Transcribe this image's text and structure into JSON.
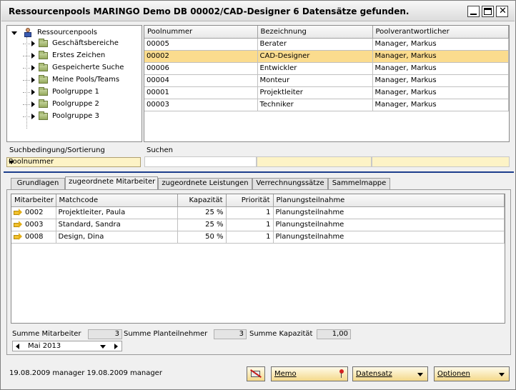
{
  "window": {
    "title": "Ressourcenpools MARINGO Demo DB 00002/CAD-Designer  6 Datensätze gefunden."
  },
  "tree": {
    "root": "Ressourcenpools",
    "items": [
      {
        "label": "Geschäftsbereiche"
      },
      {
        "label": "Erstes Zeichen"
      },
      {
        "label": "Gespeicherte Suche"
      },
      {
        "label": "Meine Pools/Teams"
      },
      {
        "label": "Poolgruppe 1"
      },
      {
        "label": "Poolgruppe 2"
      },
      {
        "label": "Poolgruppe 3"
      }
    ]
  },
  "pools": {
    "columns": [
      "Poolnummer",
      "Bezeichnung",
      "Poolverantwortlicher"
    ],
    "rows": [
      [
        "00005",
        "Berater",
        "Manager, Markus"
      ],
      [
        "00002",
        "CAD-Designer",
        "Manager, Markus"
      ],
      [
        "00006",
        "Entwickler",
        "Manager, Markus"
      ],
      [
        "00004",
        "Monteur",
        "Manager, Markus"
      ],
      [
        "00001",
        "Projektleiter",
        "Manager, Markus"
      ],
      [
        "00003",
        "Techniker",
        "Manager, Markus"
      ]
    ],
    "selected_index": 1
  },
  "search": {
    "condition_label": "Suchbedingung/Sortierung",
    "search_label": "Suchen",
    "sort_value": "Poolnummer"
  },
  "tabs": [
    {
      "label": "Grundlagen"
    },
    {
      "label": "zugeordnete Mitarbeiter"
    },
    {
      "label": "zugeordnete Leistungen"
    },
    {
      "label": "Verrechnungssätze"
    },
    {
      "label": "Sammelmappe"
    }
  ],
  "active_tab_index": 1,
  "staff": {
    "columns": [
      "Mitarbeiter",
      "Matchcode",
      "Kapazität",
      "Priorität",
      "Planungsteilnahme"
    ],
    "rows": [
      [
        "0002",
        "Projektleiter, Paula",
        "25 %",
        "1",
        "Planungsteilnahme"
      ],
      [
        "0003",
        "Standard, Sandra",
        "25 %",
        "1",
        "Planungsteilnahme"
      ],
      [
        "0008",
        "Design, Dina",
        "50 %",
        "1",
        "Planungsteilnahme"
      ]
    ]
  },
  "summary": {
    "staff_label": "Summe Mitarbeiter",
    "staff_value": "3",
    "planners_label": "Summe Planteilnehmer",
    "planners_value": "3",
    "capacity_label": "Summe Kapazität",
    "capacity_value": "1,00"
  },
  "month": "Mai 2013",
  "footer": {
    "status": "19.08.2009 manager   19.08.2009 manager",
    "memo_label": "Memo",
    "records_label": "Datensatz",
    "options_label": "Optionen"
  },
  "colors": {
    "selection": "#fbdc8e",
    "separator": "#1c3d8c",
    "button": "#f4d98a"
  }
}
